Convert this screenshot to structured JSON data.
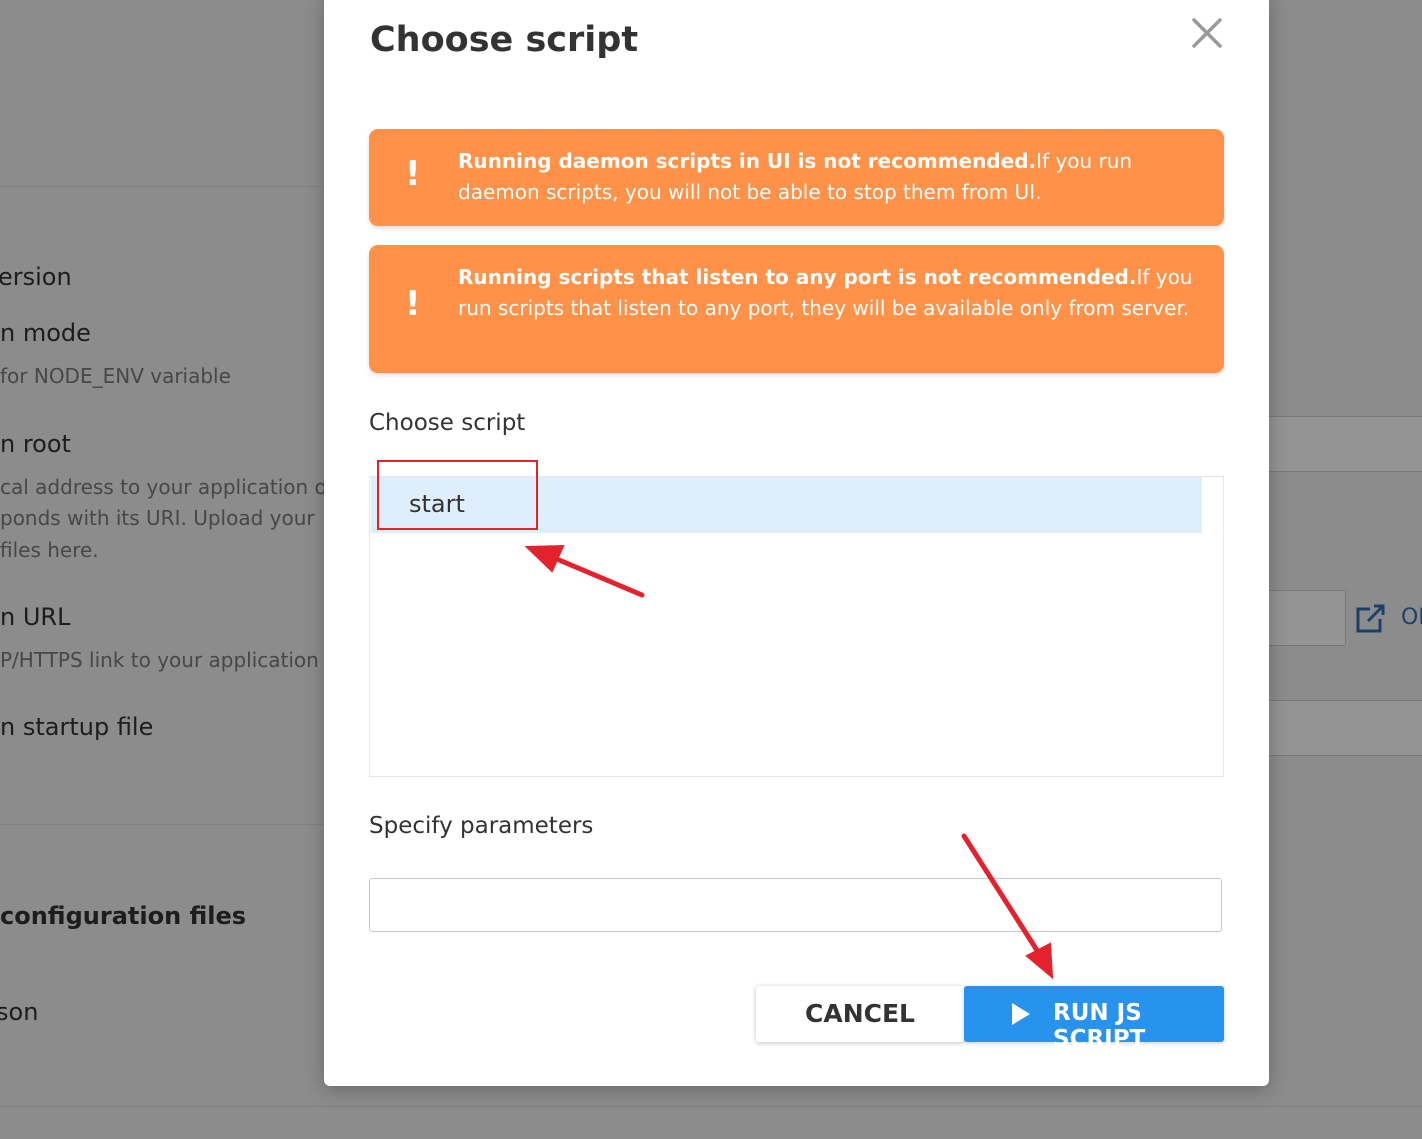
{
  "background": {
    "labels": [
      {
        "text": "ersion"
      },
      {
        "text": "n mode"
      },
      {
        "text": "for NODE_ENV variable"
      },
      {
        "text": "n root"
      },
      {
        "text": "cal address to your application on"
      },
      {
        "text": "ponds with its URI. Upload your"
      },
      {
        "text": "files here."
      },
      {
        "text": "n URL"
      },
      {
        "text": "P/HTTPS link to your application"
      },
      {
        "text": "n startup file"
      },
      {
        "text": " configuration files"
      },
      {
        "text": "son"
      }
    ],
    "open_link": "OP"
  },
  "modal": {
    "title": "Choose script",
    "close_icon": "close-icon",
    "alerts": [
      {
        "bold": "Running daemon scripts in UI is not recommended.",
        "text": "If you run daemon scripts, you will not be able to stop them from UI.",
        "icon": "!"
      },
      {
        "bold": "Running scripts that listen to any port is not recommended.",
        "text": "If you run scripts that listen to any port, they will be available only from server.",
        "icon": "!"
      }
    ],
    "choose_label": "Choose script",
    "scripts": [
      {
        "name": "start",
        "selected": true
      }
    ],
    "params_label": "Specify parameters",
    "params_value": "",
    "cancel_label": "CANCEL",
    "run_label": "RUN JS SCRIPT"
  },
  "colors": {
    "alert": "#ff9148",
    "primary": "#2893ef",
    "selected_row": "#dfeefc",
    "annotation": "#e4222d"
  }
}
